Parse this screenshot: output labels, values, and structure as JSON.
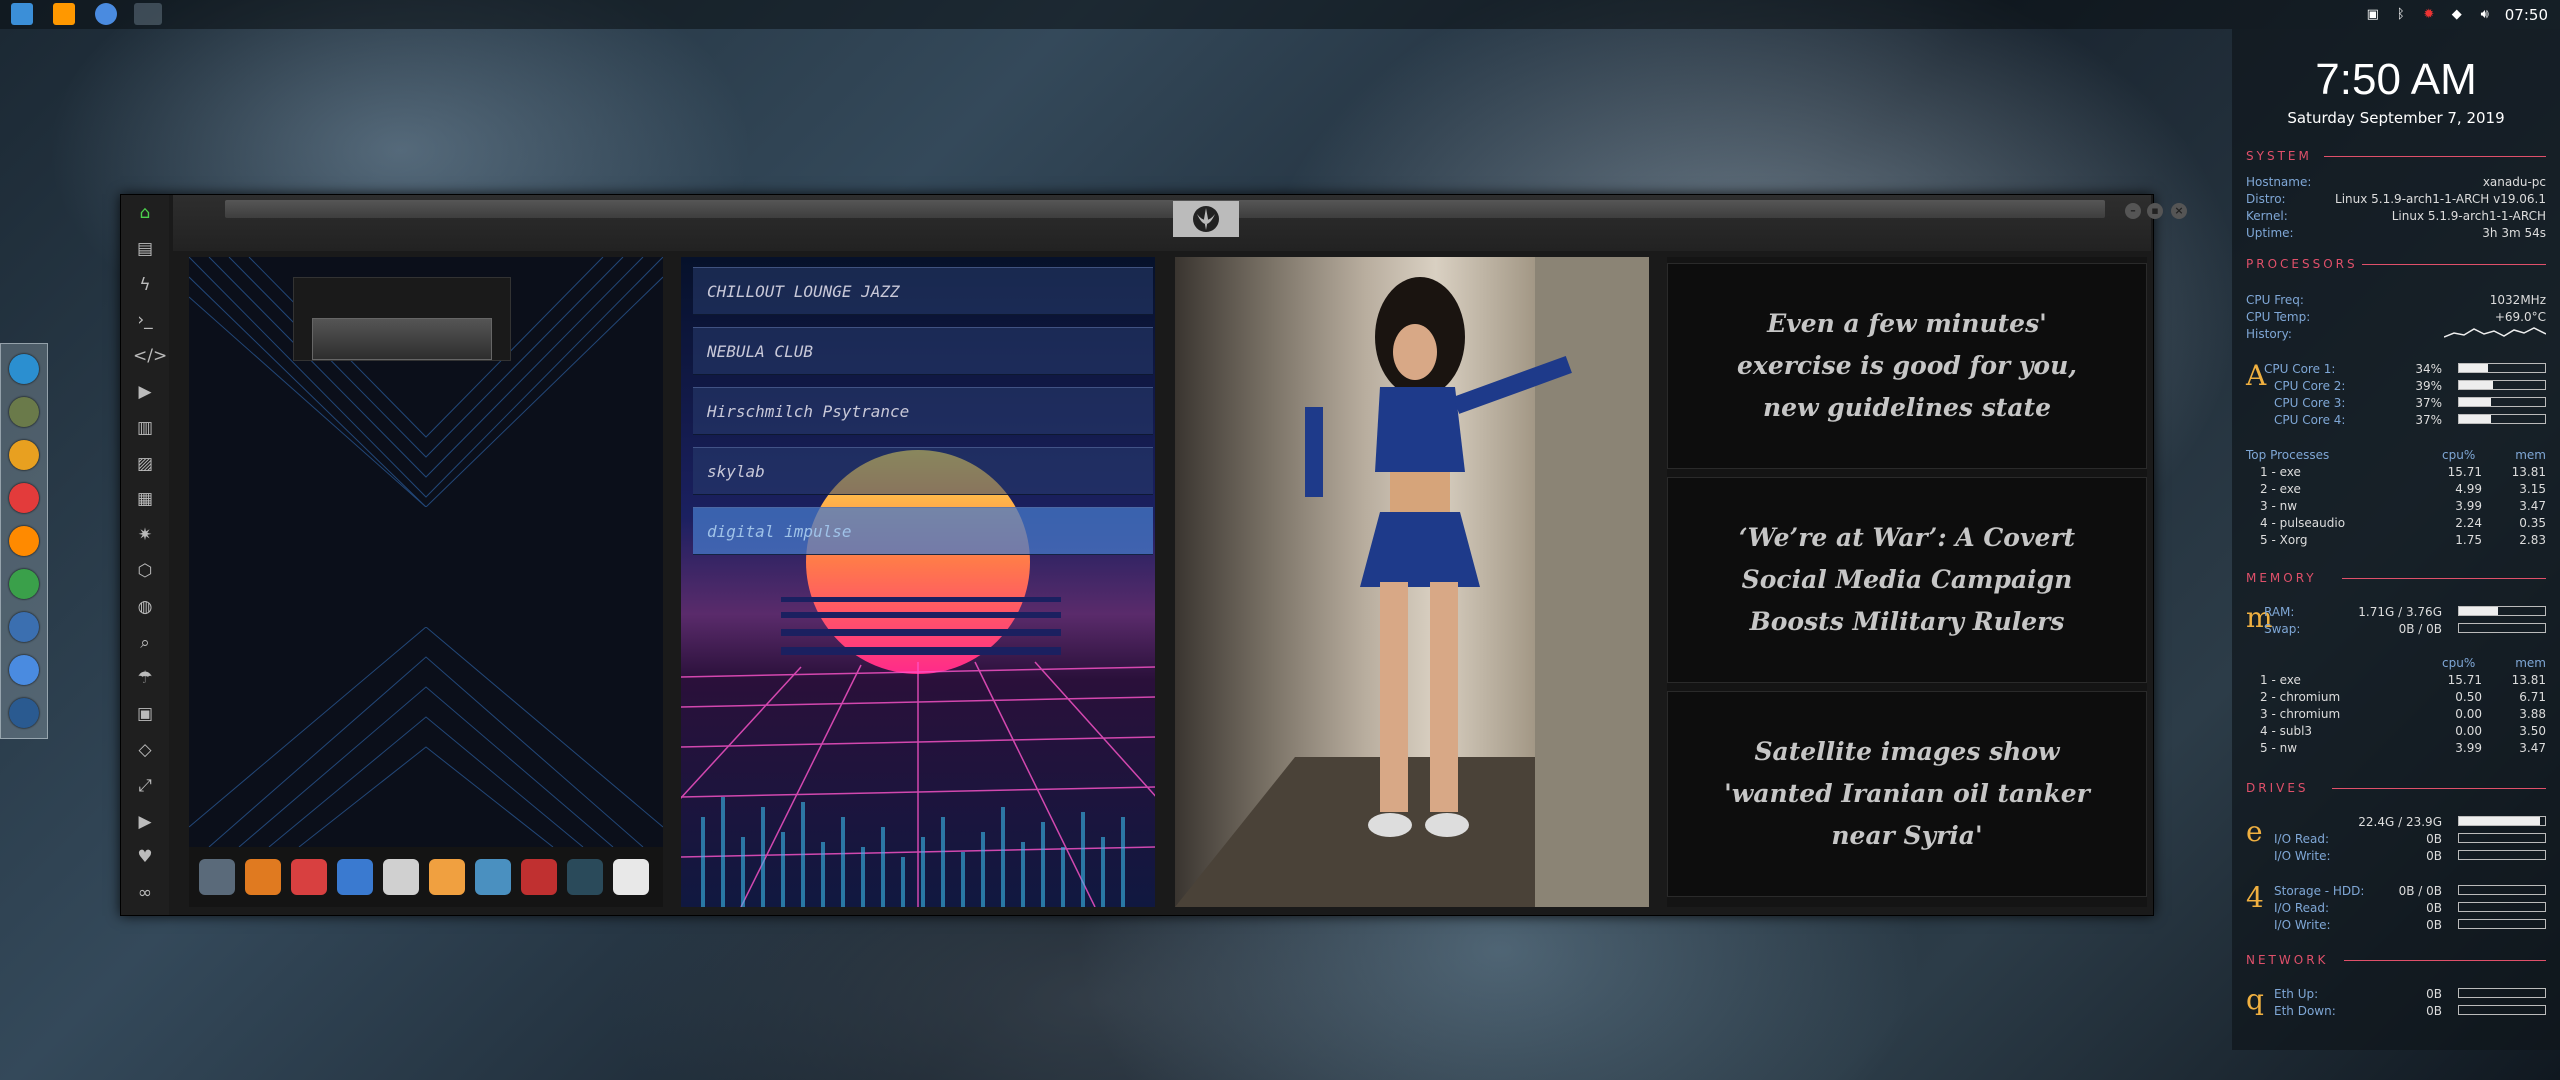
{
  "taskbar": {
    "apps": [
      {
        "name": "files-icon",
        "color": "#3b8fd8"
      },
      {
        "name": "sublime-icon",
        "color": "#ff9800"
      },
      {
        "name": "chrome-icon",
        "color": "#4a8be0"
      },
      {
        "name": "workspace-icon",
        "color": "#5a6a78"
      }
    ],
    "clock": "07:50"
  },
  "dock": {
    "items": [
      {
        "name": "finder-icon",
        "color": "#2b8fd0"
      },
      {
        "name": "finance-icon",
        "color": "#6a7a4a"
      },
      {
        "name": "settings-icon",
        "color": "#e8a020"
      },
      {
        "name": "vivaldi-icon",
        "color": "#e33b3b"
      },
      {
        "name": "sublime-dock-icon",
        "color": "#ff8a00"
      },
      {
        "name": "monitor-icon",
        "color": "#3aa04a"
      },
      {
        "name": "screen-icon",
        "color": "#3b6fb0"
      },
      {
        "name": "chromium-icon",
        "color": "#4a8be0"
      },
      {
        "name": "network-icon",
        "color": "#2a5a90"
      }
    ]
  },
  "window": {
    "sidebar_icons": [
      "home-icon",
      "document-icon",
      "bolt-icon",
      "terminal-icon",
      "code-icon",
      "play-icon",
      "book-icon",
      "image-icon",
      "news-icon",
      "star-icon",
      "hexagon-icon",
      "globe-icon",
      "search-icon",
      "umbrella-icon",
      "contact-icon",
      "diamond-icon",
      "expand-icon",
      "youtube-icon",
      "heart-icon",
      "infinity-icon"
    ],
    "radio_stations": [
      {
        "label": "CHILLOUT LOUNGE JAZZ",
        "active": false
      },
      {
        "label": "NEBULA CLUB",
        "active": false
      },
      {
        "label": "Hirschmilch Psytrance",
        "active": false
      },
      {
        "label": "skylab",
        "active": false
      },
      {
        "label": "digital impulse",
        "active": true
      }
    ],
    "news": [
      "Even a few minutes' exercise is good for you, new guidelines state",
      "‘We’re at War’: A Covert Social Media Campaign Boosts Military Rulers",
      "Satellite images show 'wanted Iranian oil tanker near Syria'"
    ]
  },
  "conky": {
    "time": "7:50 AM",
    "date": "Saturday September  7, 2019",
    "system": {
      "heading": "SYSTEM",
      "rows": [
        {
          "label": "Hostname:",
          "value": "xanadu-pc"
        },
        {
          "label": "Distro:",
          "value": "Linux 5.1.9-arch1-1-ARCH v19.06.1"
        },
        {
          "label": "Kernel:",
          "value": "Linux 5.1.9-arch1-1-ARCH"
        },
        {
          "label": "Uptime:",
          "value": "3h 3m 54s"
        }
      ]
    },
    "processors": {
      "heading": "PROCESSORS",
      "freq_label": "CPU Freq:",
      "freq": "1032MHz",
      "temp_label": "CPU Temp:",
      "temp": "+69.0°C",
      "history_label": "History:",
      "glyph": "A",
      "cores": [
        {
          "label": "CPU Core 1:",
          "value": "34%",
          "pct": 0.34
        },
        {
          "label": "CPU Core 2:",
          "value": "39%",
          "pct": 0.39
        },
        {
          "label": "CPU Core 3:",
          "value": "37%",
          "pct": 0.37
        },
        {
          "label": "CPU Core 4:",
          "value": "37%",
          "pct": 0.37
        }
      ],
      "top_label": "Top Processes",
      "col1": "cpu%",
      "col2": "mem",
      "procs": [
        {
          "name": "1  - exe",
          "cpu": "15.71",
          "mem": "13.81"
        },
        {
          "name": "2  - exe",
          "cpu": "4.99",
          "mem": "3.15"
        },
        {
          "name": "3  - nw",
          "cpu": "3.99",
          "mem": "3.47"
        },
        {
          "name": "4  - pulseaudio",
          "cpu": "2.24",
          "mem": "0.35"
        },
        {
          "name": "5  - Xorg",
          "cpu": "1.75",
          "mem": "2.83"
        }
      ]
    },
    "memory": {
      "heading": "MEMORY",
      "glyph": "m",
      "ram_label": "RAM:",
      "ram": "1.71G / 3.76G",
      "ram_pct": 0.45,
      "swap_label": "Swap:",
      "swap": "0B / 0B",
      "swap_pct": 0,
      "col1": "cpu%",
      "col2": "mem",
      "procs": [
        {
          "name": "1  - exe",
          "cpu": "15.71",
          "mem": "13.81"
        },
        {
          "name": "2  - chromium",
          "cpu": "0.50",
          "mem": "6.71"
        },
        {
          "name": "3  - chromium",
          "cpu": "0.00",
          "mem": "3.88"
        },
        {
          "name": "4  - subl3",
          "cpu": "0.00",
          "mem": "3.50"
        },
        {
          "name": "5  - nw",
          "cpu": "3.99",
          "mem": "3.47"
        }
      ]
    },
    "drives": {
      "heading": "DRIVES",
      "root": {
        "glyph": "e",
        "value": "22.4G / 23.9G",
        "pct": 0.94,
        "io_read_label": "I/O Read:",
        "io_read": "0B",
        "io_write_label": "I/O Write:",
        "io_write": "0B"
      },
      "storage": {
        "glyph": "4",
        "label": "Storage - HDD:",
        "value": "0B / 0B",
        "pct": 0,
        "io_read_label": "I/O Read:",
        "io_read": "0B",
        "io_write_label": "I/O Write:",
        "io_write": "0B"
      }
    },
    "network": {
      "heading": "NETWORK",
      "glyph": "q",
      "up_label": "Eth Up:",
      "up": "0B",
      "down_label": "Eth Down:",
      "down": "0B"
    }
  }
}
